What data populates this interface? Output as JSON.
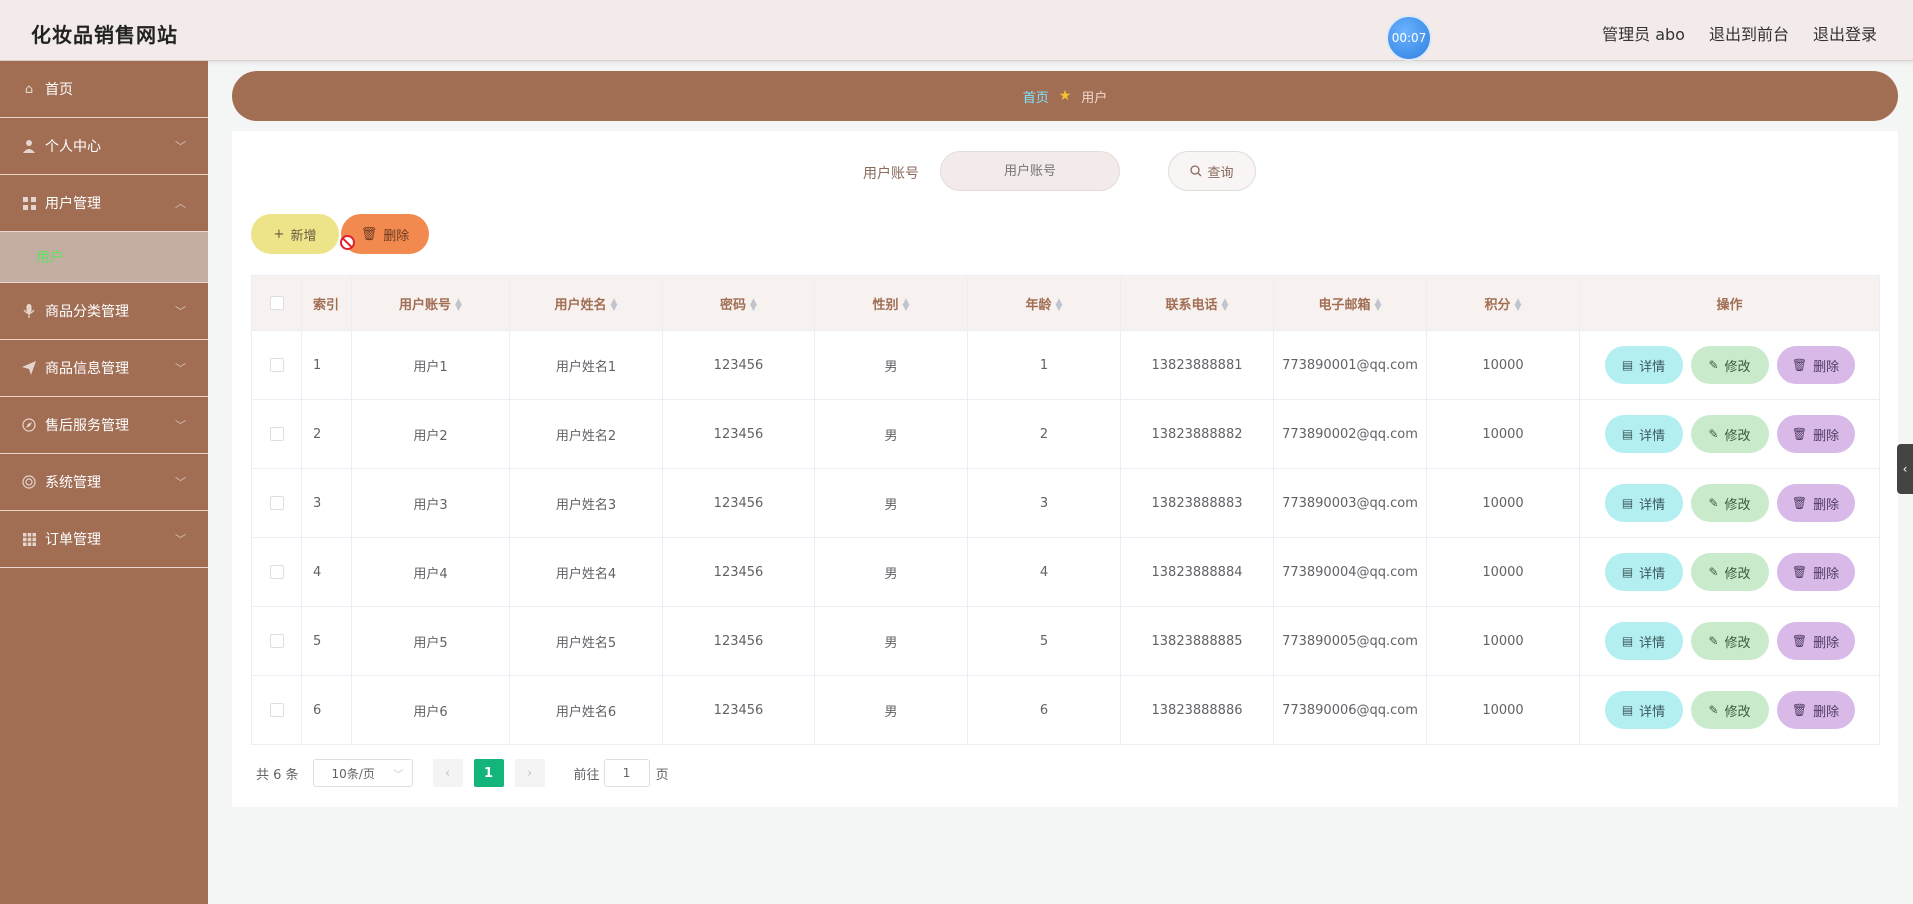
{
  "header": {
    "title": "化妆品销售网站",
    "timer": "00:07",
    "user": "管理员 abo",
    "to_front": "退出到前台",
    "logout": "退出登录"
  },
  "sidebar": {
    "items": [
      {
        "label": "首页",
        "icon": "home-icon"
      },
      {
        "label": "个人中心",
        "icon": "user-icon"
      },
      {
        "label": "用户管理",
        "icon": "grid-icon"
      },
      {
        "label": "商品分类管理",
        "icon": "microphone-icon"
      },
      {
        "label": "商品信息管理",
        "icon": "paper-plane-icon"
      },
      {
        "label": "售后服务管理",
        "icon": "compass-icon"
      },
      {
        "label": "系统管理",
        "icon": "circle-icon"
      },
      {
        "label": "订单管理",
        "icon": "grid-icon"
      }
    ],
    "sub_active": "用户"
  },
  "breadcrumb": {
    "home": "首页",
    "current": "用户"
  },
  "search": {
    "label": "用户账号",
    "placeholder": "用户账号",
    "button": "查询"
  },
  "actions": {
    "add": "新增",
    "delete": "删除"
  },
  "table": {
    "columns": [
      "索引",
      "用户账号",
      "用户姓名",
      "密码",
      "性别",
      "年龄",
      "联系电话",
      "电子邮箱",
      "积分",
      "操作"
    ],
    "rows": [
      {
        "index": "1",
        "account": "用户1",
        "name": "用户姓名1",
        "password": "123456",
        "gender": "男",
        "age": "1",
        "phone": "13823888881",
        "email": "773890001@qq.com",
        "points": "10000"
      },
      {
        "index": "2",
        "account": "用户2",
        "name": "用户姓名2",
        "password": "123456",
        "gender": "男",
        "age": "2",
        "phone": "13823888882",
        "email": "773890002@qq.com",
        "points": "10000"
      },
      {
        "index": "3",
        "account": "用户3",
        "name": "用户姓名3",
        "password": "123456",
        "gender": "男",
        "age": "3",
        "phone": "13823888883",
        "email": "773890003@qq.com",
        "points": "10000"
      },
      {
        "index": "4",
        "account": "用户4",
        "name": "用户姓名4",
        "password": "123456",
        "gender": "男",
        "age": "4",
        "phone": "13823888884",
        "email": "773890004@qq.com",
        "points": "10000"
      },
      {
        "index": "5",
        "account": "用户5",
        "name": "用户姓名5",
        "password": "123456",
        "gender": "男",
        "age": "5",
        "phone": "13823888885",
        "email": "773890005@qq.com",
        "points": "10000"
      },
      {
        "index": "6",
        "account": "用户6",
        "name": "用户姓名6",
        "password": "123456",
        "gender": "男",
        "age": "6",
        "phone": "13823888886",
        "email": "773890006@qq.com",
        "points": "10000"
      }
    ],
    "ops": {
      "detail": "详情",
      "edit": "修改",
      "delete": "删除"
    }
  },
  "pagination": {
    "total": "共 6 条",
    "page_size": "10条/页",
    "current_page": "1",
    "goto_prefix": "前往",
    "goto_value": "1",
    "goto_suffix": "页"
  },
  "colors": {
    "sidebar_bg": "#a16e54",
    "header_bg": "#f2ebe9",
    "active_green": "#5ee35e",
    "page_active": "#14b57a"
  }
}
